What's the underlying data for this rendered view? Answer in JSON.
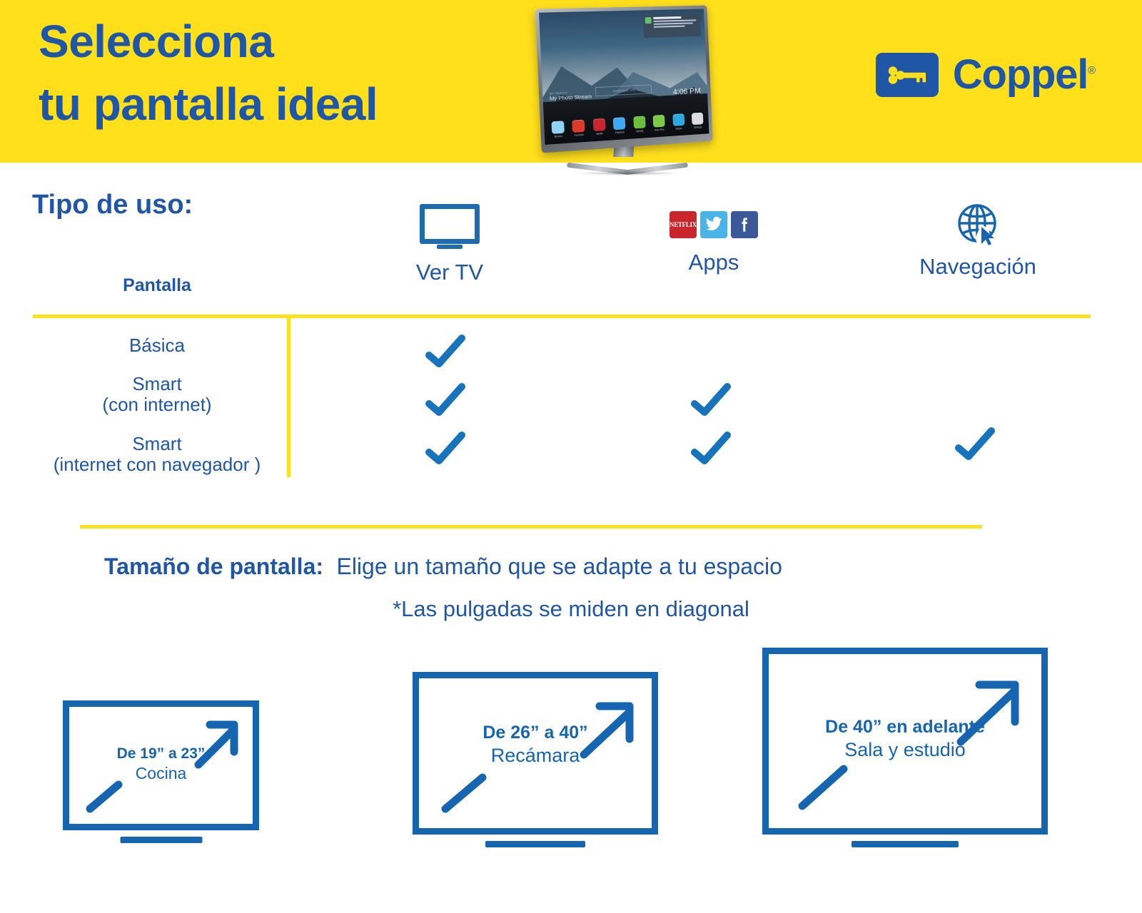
{
  "header": {
    "title": "Selecciona\ntu pantalla ideal",
    "brand": {
      "name": "Coppel",
      "registered": "®",
      "mark_icon": "key-icon"
    },
    "tv_photo": {
      "stream_label_small": "MY PHOTO",
      "stream_label": "My Photo Stream",
      "search_placeholder": "Search apps here",
      "clock": "4:06 PM",
      "notification_title": "Widget on the fan",
      "apps": [
        {
          "name": "Movies",
          "color": "#8fd3f4"
        },
        {
          "name": "YouTube",
          "color": "#d93a2b"
        },
        {
          "name": "Netflix",
          "color": "#c9252c"
        },
        {
          "name": "Pandora",
          "color": "#3fa9f5"
        },
        {
          "name": "Spotify",
          "color": "#6abf3c"
        },
        {
          "name": "Hulu Plus",
          "color": "#7ac943"
        },
        {
          "name": "Skype",
          "color": "#29a9e0"
        },
        {
          "name": "Settings",
          "color": "#dcdcdc"
        }
      ]
    }
  },
  "usage": {
    "section_title": "Tipo de uso:",
    "columns": [
      {
        "key": "pantalla",
        "label": "Pantalla",
        "icon": "none"
      },
      {
        "key": "ver_tv",
        "label": "Ver TV",
        "icon": "tv-monitor-icon"
      },
      {
        "key": "apps",
        "label": "Apps",
        "icon": "social-apps-icon"
      },
      {
        "key": "navegacion",
        "label": "Navegación",
        "icon": "globe-cursor-icon"
      }
    ],
    "app_icons": [
      {
        "name": "netflix-icon",
        "label": "NETFLIX",
        "color": "#C9252C"
      },
      {
        "name": "twitter-icon",
        "label": "",
        "color": "#4AB3E8"
      },
      {
        "name": "facebook-icon",
        "label": "f",
        "color": "#3B5998"
      }
    ],
    "rows": [
      {
        "label_line1": "Básica",
        "label_line2": "",
        "ver_tv": true,
        "apps": false,
        "navegacion": false
      },
      {
        "label_line1": "Smart",
        "label_line2": "(con internet)",
        "ver_tv": true,
        "apps": true,
        "navegacion": false
      },
      {
        "label_line1": "Smart",
        "label_line2": "(internet con navegador )",
        "ver_tv": true,
        "apps": true,
        "navegacion": true
      }
    ]
  },
  "size": {
    "title": "Tamaño de pantalla:",
    "subtitle": "Elige un tamaño que se adapte a tu espacio",
    "note": "*Las pulgadas se miden en diagonal",
    "boxes": [
      {
        "range": "De 19” a 23”",
        "room": "Cocina"
      },
      {
        "range": "De 26” a 40”",
        "room": "Recámara"
      },
      {
        "range": "De 40” en adelante",
        "room": "Sala y estudio"
      }
    ]
  },
  "colors": {
    "yellow": "#FFE01B",
    "blue": "#1F56A5",
    "icon_blue": "#1565B0",
    "check_blue": "#1673BC"
  }
}
